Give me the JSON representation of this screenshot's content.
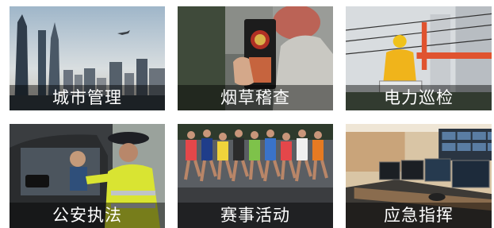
{
  "tiles": [
    {
      "id": "city-management",
      "label": "城市管理",
      "icon": "city-skyline-photo"
    },
    {
      "id": "tobacco-inspection",
      "label": "烟草稽查",
      "icon": "inspector-badge-photo"
    },
    {
      "id": "power-inspection",
      "label": "电力巡检",
      "icon": "power-line-worker-photo"
    },
    {
      "id": "public-security",
      "label": "公安执法",
      "icon": "police-officer-photo"
    },
    {
      "id": "sports-events",
      "label": "赛事活动",
      "icon": "marathon-runners-photo"
    },
    {
      "id": "emergency-command",
      "label": "应急指挥",
      "icon": "control-room-photo"
    }
  ],
  "colors": {
    "caption_overlay": "rgba(0,0,0,0.45)",
    "caption_text": "#ffffff"
  }
}
